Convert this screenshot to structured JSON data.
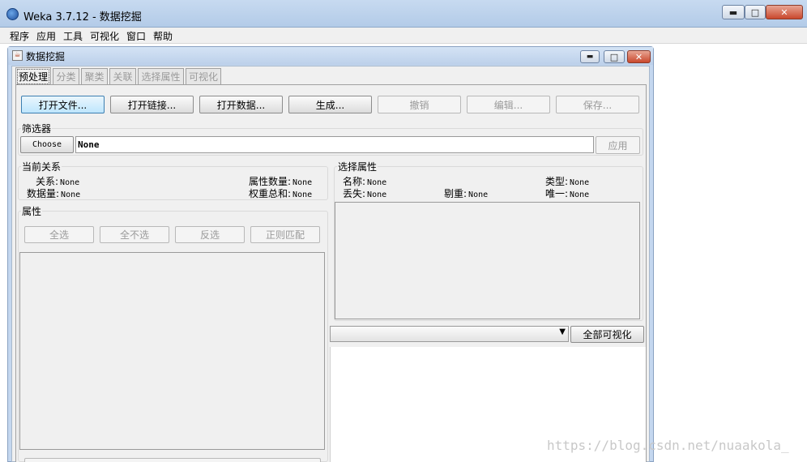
{
  "app": {
    "title": "Weka 3.7.12 - 数据挖掘",
    "icon": "weka-bird-icon",
    "window_controls": [
      "minimize",
      "maximize",
      "close"
    ]
  },
  "menu": {
    "items": [
      "程序",
      "应用",
      "工具",
      "可视化",
      "窗口",
      "帮助"
    ]
  },
  "inner_window": {
    "title": "数据挖掘"
  },
  "tabs": [
    {
      "label": "预处理",
      "active": true
    },
    {
      "label": "分类",
      "active": false
    },
    {
      "label": "聚类",
      "active": false
    },
    {
      "label": "关联",
      "active": false
    },
    {
      "label": "选择属性",
      "active": false
    },
    {
      "label": "可视化",
      "active": false
    }
  ],
  "toolbar": {
    "open_file": "打开文件...",
    "open_url": "打开链接...",
    "open_db": "打开数据...",
    "generate": "生成...",
    "undo": "撤销",
    "edit": "编辑...",
    "save": "保存..."
  },
  "filter": {
    "label": "筛选器",
    "choose": "Choose",
    "value": "None",
    "apply": "应用"
  },
  "current_relation": {
    "label": "当前关系",
    "relation_label": "关系:",
    "relation_value": "None",
    "instances_label": "数据量:",
    "instances_value": "None",
    "attributes_label": "属性数量:",
    "attributes_value": "None",
    "sum_weights_label": "权重总和:",
    "sum_weights_value": "None"
  },
  "attributes": {
    "label": "属性",
    "all": "全选",
    "none": "全不选",
    "invert": "反选",
    "pattern": "正则匹配"
  },
  "selected_attribute": {
    "label": "选择属性",
    "name_label": "名称:",
    "name_value": "None",
    "type_label": "类型:",
    "type_value": "None",
    "missing_label": "丢失:",
    "missing_value": "None",
    "distinct_label": "剔重:",
    "distinct_value": "None",
    "unique_label": "唯一:",
    "unique_value": "None"
  },
  "visualize": {
    "class_select_value": "",
    "visualize_all": "全部可视化"
  },
  "watermark": "https://blog.csdn.net/nuaakola_",
  "colors": {
    "titlebar": "#b3cbe8",
    "panel": "#f0f0f0",
    "primary_button": "#bee6fd",
    "close_button": "#c9482d"
  }
}
